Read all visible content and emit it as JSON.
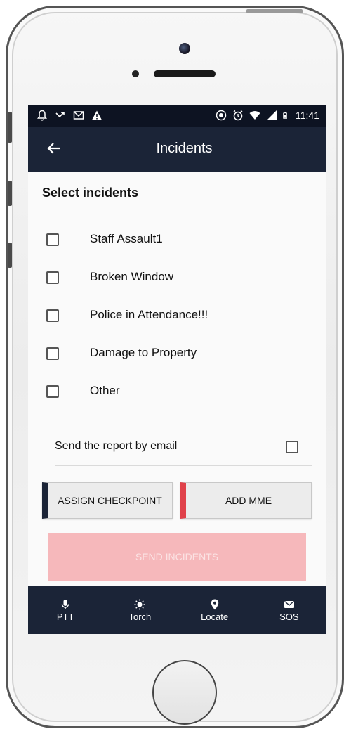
{
  "status_bar": {
    "time": "11:41"
  },
  "app_bar": {
    "title": "Incidents"
  },
  "content": {
    "section_title": "Select incidents",
    "incidents": [
      {
        "label": "Staff Assault1",
        "checked": false
      },
      {
        "label": "Broken Window",
        "checked": false
      },
      {
        "label": "Police in Attendance!!!",
        "checked": false
      },
      {
        "label": "Damage to Property",
        "checked": false
      },
      {
        "label": "Other",
        "checked": false
      }
    ],
    "email_option": {
      "label": "Send the report by email",
      "checked": false
    },
    "assign_checkpoint_label": "ASSIGN CHECKPOINT",
    "add_mme_label": "ADD MME",
    "send_incidents_label": "SEND INCIDENTS"
  },
  "bottom_nav": {
    "items": [
      {
        "label": "PTT",
        "icon": "microphone-icon"
      },
      {
        "label": "Torch",
        "icon": "sun-icon"
      },
      {
        "label": "Locate",
        "icon": "location-pin-icon"
      },
      {
        "label": "SOS",
        "icon": "envelope-icon"
      }
    ]
  },
  "colors": {
    "status_bar": "#0d1322",
    "app_bar": "#1b2437",
    "accent_red": "#e0414a",
    "send_button": "#f6b8bb"
  }
}
